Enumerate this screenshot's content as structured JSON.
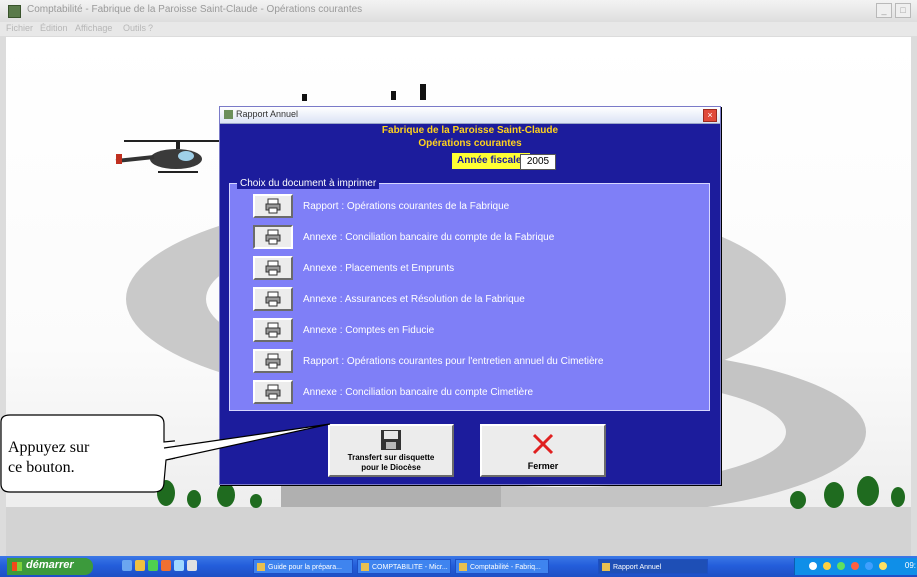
{
  "app": {
    "title": "Comptabilité - Fabrique de la Paroisse Saint-Claude - Opérations courantes",
    "menu": [
      "Fichier",
      "Édition",
      "Affichage",
      "Outils",
      "?"
    ],
    "window_buttons": [
      "_",
      "□"
    ]
  },
  "dialog": {
    "title": "Rapport Annuel",
    "close_label": "×",
    "org_name": "Fabrique de la Paroisse Saint-Claude",
    "op_title": "Opérations courantes",
    "fiscal_label": "Année fiscale:",
    "fiscal_year": "2005",
    "group_title": "Choix du document à imprimer",
    "documents": [
      {
        "label": "Rapport : Opérations courantes de la Fabrique"
      },
      {
        "label": "Annexe : Conciliation bancaire du compte de la Fabrique"
      },
      {
        "label": "Annexe : Placements et Emprunts"
      },
      {
        "label": "Annexe : Assurances et Résolution de la Fabrique"
      },
      {
        "label": "Annexe : Comptes en Fiducie"
      },
      {
        "label": "Rapport : Opérations courantes pour l'entretien annuel du Cimetière"
      },
      {
        "label": "Annexe : Conciliation bancaire du compte Cimetière"
      }
    ],
    "transfer_label_1": "Transfert sur disquette",
    "transfer_label_2": "pour le Diocèse",
    "close_btn_label": "Fermer"
  },
  "callout": {
    "line1": "Appuyez sur",
    "line2": "ce bouton."
  },
  "taskbar": {
    "start_label": "démarrer",
    "tasks": [
      {
        "label": "Guide pour la prépara..."
      },
      {
        "label": "COMPTABILITE - Micr..."
      },
      {
        "label": "Comptabilité - Fabriq..."
      },
      {
        "label": "Rapport Annuel"
      }
    ],
    "clock": "09:"
  },
  "colors": {
    "dialog_bg": "#1c1c9c",
    "group_bg": "#7f7ff7",
    "header_text": "#ffd21e",
    "fiscal_label_bg": "#ffff33",
    "close_x": "#e02020",
    "taskbar": "#245edb"
  }
}
